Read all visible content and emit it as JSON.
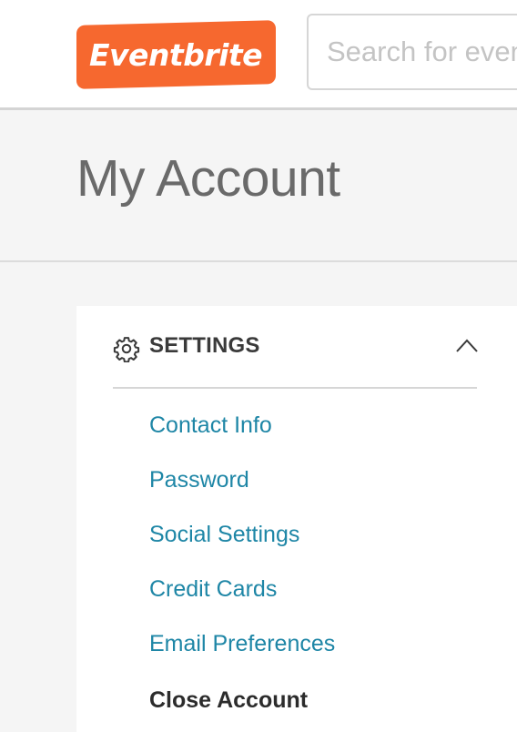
{
  "header": {
    "logo_text": "Eventbrite",
    "search_placeholder": "Search for events"
  },
  "page": {
    "title": "My Account"
  },
  "settings": {
    "heading": "SETTINGS",
    "expanded": true,
    "links": [
      {
        "label": "Contact Info"
      },
      {
        "label": "Password"
      },
      {
        "label": "Social Settings"
      },
      {
        "label": "Credit Cards"
      },
      {
        "label": "Email Preferences"
      },
      {
        "label": "Close Account"
      }
    ]
  },
  "colors": {
    "brand": "#f6682f",
    "link": "#1e86a6",
    "heading": "#3a3a3a"
  }
}
